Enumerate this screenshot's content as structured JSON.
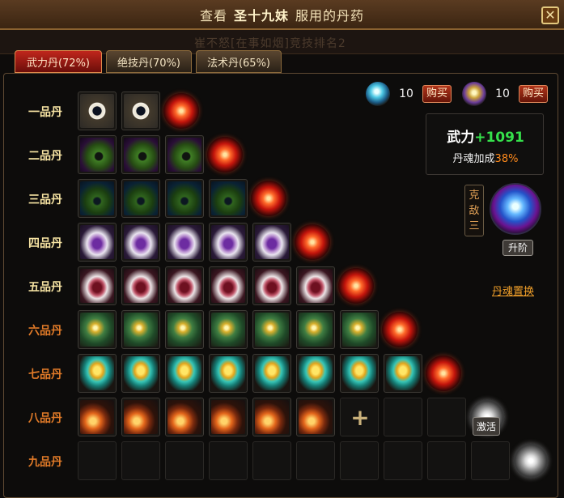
{
  "window": {
    "title_prefix": "查看",
    "title_name": "圣十九妹",
    "title_suffix": "服用的丹药",
    "close_glyph": "✕"
  },
  "background_text": "崔不怒[在事如烟]竞技排名2",
  "tabs": [
    {
      "label": "武力丹(72%)",
      "active": true
    },
    {
      "label": "绝技丹(70%)",
      "active": false
    },
    {
      "label": "法术丹(65%)",
      "active": false
    }
  ],
  "resources": [
    {
      "icon": "crystal-globe-icon",
      "count": "10",
      "buy_label": "购买"
    },
    {
      "icon": "gold-pouch-icon",
      "count": "10",
      "buy_label": "购买"
    }
  ],
  "stat": {
    "name": "武力",
    "bonus": "+1091",
    "soul_label": "丹魂加成",
    "soul_value": "38%"
  },
  "kedi_label": "克\n敌\n三",
  "upgrade_label": "升阶",
  "swap_label": "丹魂置换",
  "activate_label": "激活",
  "colors": {
    "label_gold": "#f7e4a3",
    "label_orange": "#e07a28",
    "stat_green": "#35e04b",
    "soul_orange": "#ff8a1c"
  },
  "grades": [
    {
      "label": "一品丹",
      "icon": "pill-white-diamond-icon",
      "filled": 2,
      "total": 2,
      "orb": "red-fire-orb-icon"
    },
    {
      "label": "二品丹",
      "icon": "herb-leaf-icon",
      "filled": 3,
      "total": 3,
      "orb": "red-fire-orb-icon"
    },
    {
      "label": "三品丹",
      "icon": "herb-leaf-blue-icon",
      "filled": 4,
      "total": 4,
      "orb": "red-fire-orb-icon"
    },
    {
      "label": "四品丹",
      "icon": "purple-pill-dish-icon",
      "filled": 5,
      "total": 5,
      "orb": "orange-fire-orb-icon"
    },
    {
      "label": "五品丹",
      "icon": "red-pill-dish-icon",
      "filled": 6,
      "total": 6,
      "orb": "red-fire-orb-icon"
    },
    {
      "label": "六品丹",
      "icon": "jade-box-icon",
      "filled": 7,
      "total": 7,
      "orb": "red-fire-orb-icon"
    },
    {
      "label": "七品丹",
      "icon": "golden-cauldron-icon",
      "filled": 8,
      "total": 8,
      "orb": "red-fire-orb-icon"
    },
    {
      "label": "八品丹",
      "icon": "flame-gourd-icon",
      "filled": 6,
      "total": 9,
      "orb": "white-swirl-orb-icon",
      "orb_label": "激活"
    },
    {
      "label": "九品丹",
      "icon": "",
      "filled": 0,
      "total": 10,
      "orb": "white-swirl-orb-icon"
    }
  ]
}
